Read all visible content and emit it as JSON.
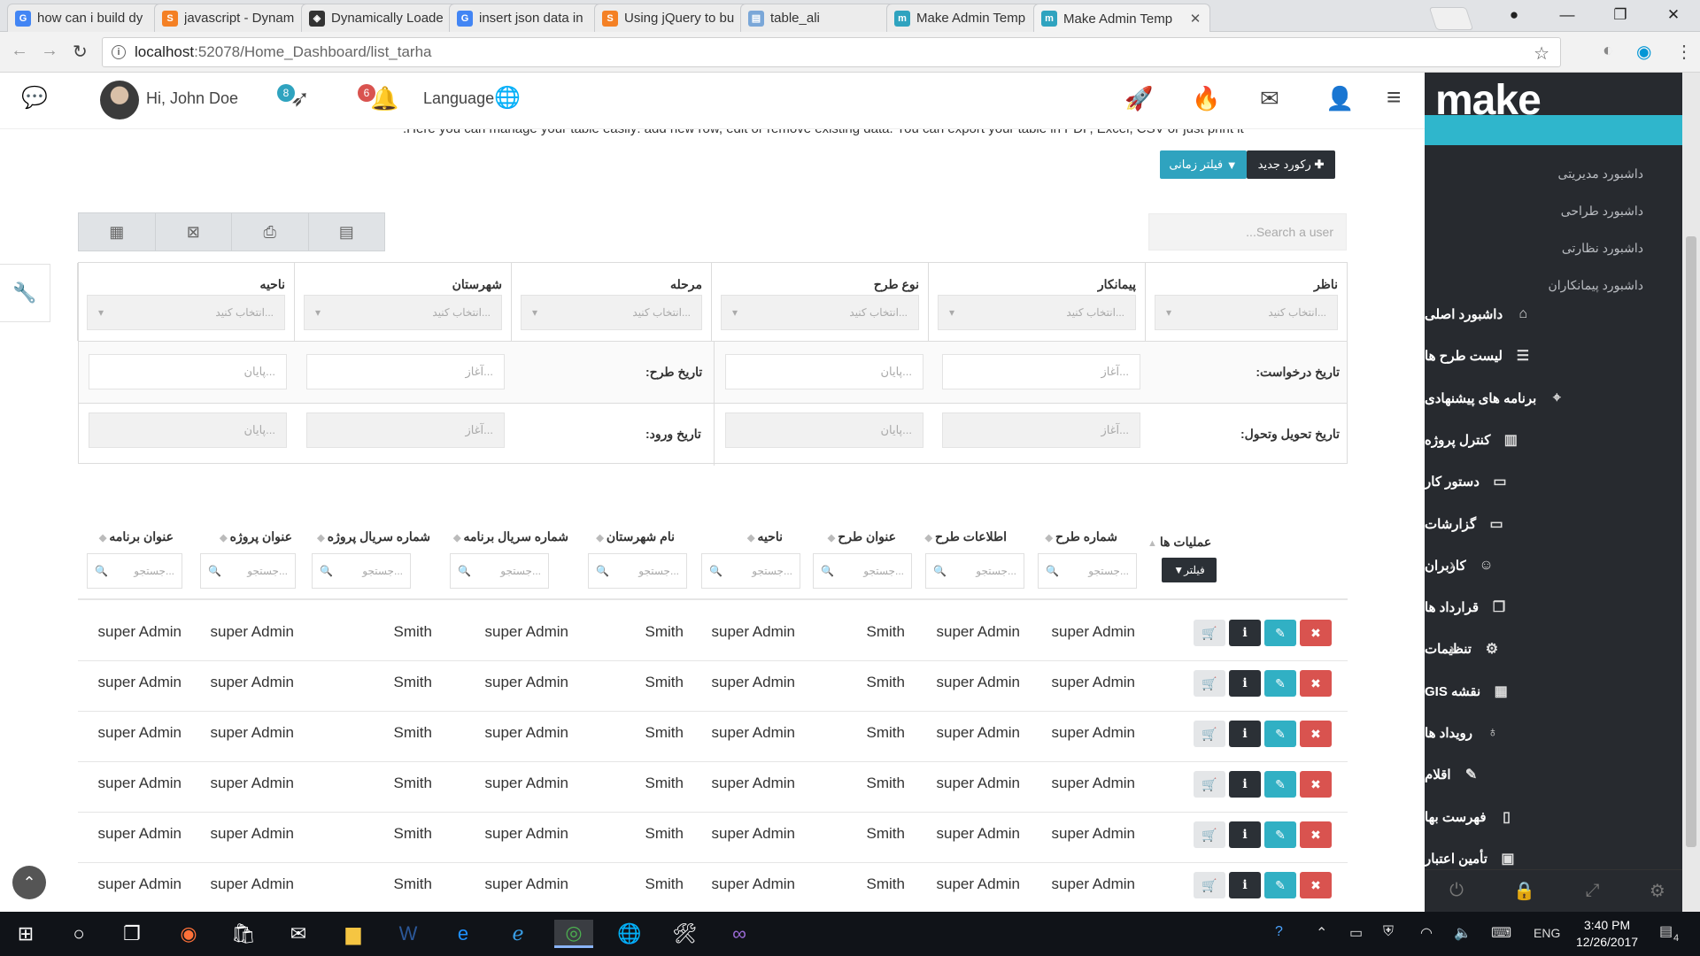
{
  "browser": {
    "tabs": [
      {
        "title": "how can i build dy",
        "icon": "google-icon",
        "color": "#4285f4",
        "glyph": "G"
      },
      {
        "title": "javascript - Dynam",
        "icon": "stackoverflow-icon",
        "color": "#f48024",
        "glyph": "S"
      },
      {
        "title": "Dynamically Loade",
        "icon": "codepen-icon",
        "color": "#333333",
        "glyph": "◈"
      },
      {
        "title": "insert json data in",
        "icon": "google-icon",
        "color": "#4285f4",
        "glyph": "G"
      },
      {
        "title": "Using jQuery to bu",
        "icon": "stackoverflow-icon",
        "color": "#f48024",
        "glyph": "S"
      },
      {
        "title": "table_ali",
        "icon": "document-icon",
        "color": "#7aa7d8",
        "glyph": "▤"
      },
      {
        "title": "Make Admin Temp",
        "icon": "make-icon",
        "color": "#2fa3bf",
        "glyph": "m"
      },
      {
        "title": "Make Admin Temp",
        "icon": "make-icon",
        "color": "#2fa3bf",
        "glyph": "m"
      }
    ],
    "url_host": "localhost",
    "url_rest": ":52078/Home_Dashboard/list_tarha"
  },
  "header": {
    "greeting": "Hi, John Doe",
    "messages_badge": "8",
    "notif_badge": "6",
    "language": "Language"
  },
  "sidebar": {
    "logo": "make",
    "active_item": "داشبورد",
    "sub_items": [
      "داشبورد مدیریتی",
      "داشبورد طراحی",
      "داشبورد نظارتی",
      "داشبورد پیمانکاران"
    ],
    "items": [
      {
        "label": "داشبورد اصلی",
        "icon": "home-icon",
        "glyph": "⌂",
        "chevron": false
      },
      {
        "label": "لیست طرح ها",
        "icon": "layers-icon",
        "glyph": "☰",
        "chevron": false
      },
      {
        "label": "برنامه های پیشنهادی",
        "icon": "tag-icon",
        "glyph": "⌖",
        "chevron": false
      },
      {
        "label": "کنترل پروژه",
        "icon": "bar-chart-icon",
        "glyph": "▥",
        "chevron": false
      },
      {
        "label": "دستور کار",
        "icon": "monitor-icon",
        "glyph": "▭",
        "chevron": false
      },
      {
        "label": "گزارشات",
        "icon": "laptop-icon",
        "glyph": "▭",
        "chevron": false
      },
      {
        "label": "کاربران",
        "icon": "user-icon",
        "glyph": "☺",
        "chevron": true
      },
      {
        "label": "قرارداد ها",
        "icon": "copy-icon",
        "glyph": "❐",
        "chevron": false
      },
      {
        "label": "تنظیمات",
        "icon": "gear-icon",
        "glyph": "⚙",
        "chevron": true
      },
      {
        "label": "نقشه GIS",
        "icon": "map-icon",
        "glyph": "▦",
        "chevron": false
      },
      {
        "label": "رویداد ها",
        "icon": "bulb-icon",
        "glyph": "♁",
        "chevron": false
      },
      {
        "label": "اقلام",
        "icon": "edit-icon",
        "glyph": "✎",
        "chevron": false
      },
      {
        "label": "فهرست بها",
        "icon": "file-icon",
        "glyph": "▯",
        "chevron": false
      },
      {
        "label": "تأمین اعتبار",
        "icon": "money-icon",
        "glyph": "▣",
        "chevron": false
      }
    ]
  },
  "main": {
    "description": ".Here you can manage your table easily: add new row, edit or remove existing data. You can export your table in PDF, Excel, CSV or just print it",
    "new_record": "رکورد جدید",
    "time_filter": "فیلتر زمانی",
    "search_user_placeholder": "...Search a user",
    "filters": {
      "selects": [
        {
          "label": "ناظر",
          "placeholder": "انتخاب کنید..."
        },
        {
          "label": "پیمانکار",
          "placeholder": "انتخاب کنید..."
        },
        {
          "label": "نوع طرح",
          "placeholder": "انتخاب کنید..."
        },
        {
          "label": "مرحله",
          "placeholder": "انتخاب کنید..."
        },
        {
          "label": "شهرستان",
          "placeholder": "انتخاب کنید..."
        },
        {
          "label": "ناحیه",
          "placeholder": "انتخاب کنید..."
        }
      ],
      "request_date": "تاریخ درخواست:",
      "plan_date": "تاریخ طرح:",
      "delivery_date": "تاریخ تحویل وتحول:",
      "entry_date": "تاریخ ورود:",
      "start_placeholder": "آغاز...",
      "end_placeholder": "پایان..."
    },
    "table": {
      "operations_header": "عملیات ها",
      "filter_button": "فیلتر",
      "search_placeholder": "جستجو...",
      "columns": [
        "شماره طرح",
        "اطلاعات طرح",
        "عنوان طرح",
        "ناحیه",
        "نام شهرستان",
        "شماره سریال برنامه",
        "شماره سریال پروژه",
        "عنوان پروژه",
        "عنوان برنامه"
      ],
      "rows": [
        [
          "super Admin",
          "super Admin",
          "Smith",
          "super Admin",
          "Smith",
          "super Admin",
          "Smith",
          "super Admin",
          "super Admin"
        ],
        [
          "super Admin",
          "super Admin",
          "Smith",
          "super Admin",
          "Smith",
          "super Admin",
          "Smith",
          "super Admin",
          "super Admin"
        ],
        [
          "super Admin",
          "super Admin",
          "Smith",
          "super Admin",
          "Smith",
          "super Admin",
          "Smith",
          "super Admin",
          "super Admin"
        ],
        [
          "super Admin",
          "super Admin",
          "Smith",
          "super Admin",
          "Smith",
          "super Admin",
          "Smith",
          "super Admin",
          "super Admin"
        ],
        [
          "super Admin",
          "super Admin",
          "Smith",
          "super Admin",
          "Smith",
          "super Admin",
          "Smith",
          "super Admin",
          "super Admin"
        ],
        [
          "super Admin",
          "super Admin",
          "Smith",
          "super Admin",
          "Smith",
          "super Admin",
          "Smith",
          "super Admin",
          "super Admin"
        ]
      ]
    }
  },
  "taskbar": {
    "time": "3:40 PM",
    "date": "12/26/2017",
    "lang": "ENG",
    "notif_count": "4"
  }
}
